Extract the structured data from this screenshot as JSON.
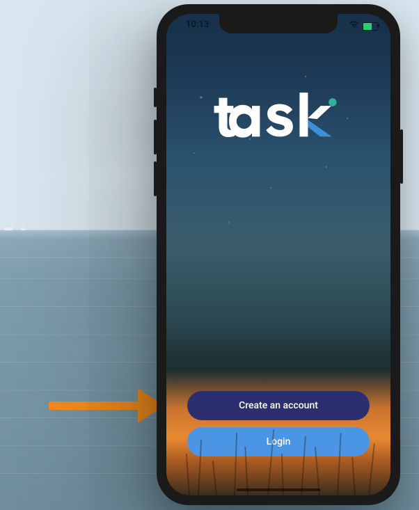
{
  "statusbar": {
    "time": "10:13"
  },
  "brand": {
    "name": "task"
  },
  "buttons": {
    "create_account": "Create an account",
    "login": "Login"
  }
}
